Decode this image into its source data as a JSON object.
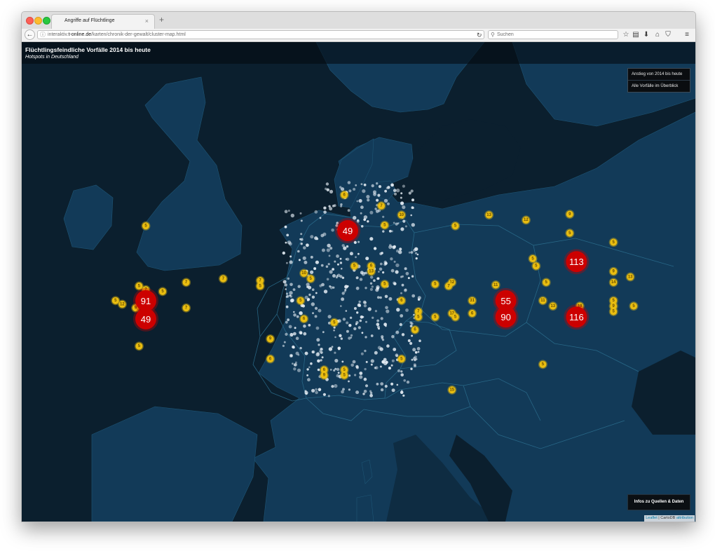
{
  "browser": {
    "tab_title": "Angriffe auf Flüchtlinge",
    "tab_close_glyph": "×",
    "new_tab_glyph": "+",
    "url": {
      "prefix": "interaktiv.",
      "domain": "t-online.de",
      "path": "/karten/chronik-der-gewalt/cluster-map.html"
    },
    "search_placeholder": "Suchen",
    "back_glyph": "←",
    "info_glyph": "ⓘ",
    "reload_glyph": "↻",
    "search_glyph": "⚲",
    "toolbar_icons": [
      {
        "name": "bookmark-star-icon",
        "glyph": "☆"
      },
      {
        "name": "reading-list-icon",
        "glyph": "▤"
      },
      {
        "name": "download-icon",
        "glyph": "⬇"
      },
      {
        "name": "home-icon",
        "glyph": "⌂"
      },
      {
        "name": "pocket-icon",
        "glyph": "⛉"
      },
      {
        "name": "menu-icon",
        "glyph": "≡"
      }
    ]
  },
  "page": {
    "title": "Flüchtlingsfeindliche Vorfälle 2014 bis heute",
    "subtitle": "Hotspots in Deutschland"
  },
  "view_controls": [
    {
      "label": "Anstieg von 2014 bis heute"
    },
    {
      "label": "Alle Vorfälle im Überblick"
    }
  ],
  "info_button_label": "Infos zu Quellen & Daten",
  "attribution": {
    "leaflet": "Leaflet",
    "separator": " | CartoDB ",
    "link": "attribution"
  },
  "colors": {
    "map_water": "#0b1f2e",
    "map_land": "#123a58",
    "map_border": "#2c6f8f",
    "large_cluster": "#cc0000",
    "medium_cluster": "#e9bd10",
    "medium_cluster_text": "#6a4f00",
    "point_dot": "#e6eef5"
  },
  "clusters_large": [
    {
      "count": "49",
      "lat": 53.37,
      "lng": 10.0
    },
    {
      "count": "113",
      "lat": 52.52,
      "lng": 13.4
    },
    {
      "count": "91",
      "lat": 51.45,
      "lng": 7.0
    },
    {
      "count": "49",
      "lat": 50.95,
      "lng": 7.0
    },
    {
      "count": "55",
      "lat": 51.45,
      "lng": 12.35
    },
    {
      "count": "90",
      "lat": 51.0,
      "lng": 12.35
    },
    {
      "count": "116",
      "lat": 51.0,
      "lng": 13.4
    }
  ],
  "clusters_medium": [
    {
      "count": "6",
      "lat": 54.35,
      "lng": 9.95
    },
    {
      "count": "7",
      "lat": 54.05,
      "lng": 10.5
    },
    {
      "count": "10",
      "lat": 53.8,
      "lng": 10.8
    },
    {
      "count": "13",
      "lat": 53.8,
      "lng": 12.1
    },
    {
      "count": "9",
      "lat": 53.82,
      "lng": 13.3
    },
    {
      "count": "12",
      "lat": 53.66,
      "lng": 12.65
    },
    {
      "count": "5",
      "lat": 53.52,
      "lng": 10.55
    },
    {
      "count": "5",
      "lat": 53.5,
      "lng": 11.6
    },
    {
      "count": "5",
      "lat": 53.5,
      "lng": 7.0
    },
    {
      "count": "5",
      "lat": 53.3,
      "lng": 13.3
    },
    {
      "count": "5",
      "lat": 53.05,
      "lng": 13.95
    },
    {
      "count": "5",
      "lat": 52.6,
      "lng": 12.75
    },
    {
      "count": "5",
      "lat": 52.4,
      "lng": 12.8
    },
    {
      "count": "9",
      "lat": 52.25,
      "lng": 13.95
    },
    {
      "count": "13",
      "lat": 52.1,
      "lng": 14.2
    },
    {
      "count": "14",
      "lat": 51.95,
      "lng": 13.95
    },
    {
      "count": "5",
      "lat": 52.4,
      "lng": 10.1
    },
    {
      "count": "6",
      "lat": 52.4,
      "lng": 10.35
    },
    {
      "count": "13",
      "lat": 52.25,
      "lng": 10.35
    },
    {
      "count": "10",
      "lat": 52.2,
      "lng": 9.35
    },
    {
      "count": "5",
      "lat": 52.05,
      "lng": 9.45
    },
    {
      "count": "7",
      "lat": 52.05,
      "lng": 8.15
    },
    {
      "count": "7",
      "lat": 52.0,
      "lng": 8.7
    },
    {
      "count": "7",
      "lat": 51.95,
      "lng": 7.6
    },
    {
      "count": "5",
      "lat": 51.85,
      "lng": 8.7
    },
    {
      "count": "5",
      "lat": 51.9,
      "lng": 10.55
    },
    {
      "count": "5",
      "lat": 51.9,
      "lng": 11.3
    },
    {
      "count": "12",
      "lat": 51.95,
      "lng": 11.55
    },
    {
      "count": "7",
      "lat": 51.85,
      "lng": 11.5
    },
    {
      "count": "11",
      "lat": 51.88,
      "lng": 12.2
    },
    {
      "count": "5",
      "lat": 51.95,
      "lng": 12.95
    },
    {
      "count": "5",
      "lat": 51.85,
      "lng": 6.9
    },
    {
      "count": "7",
      "lat": 51.75,
      "lng": 7.0
    },
    {
      "count": "5",
      "lat": 51.7,
      "lng": 7.25
    },
    {
      "count": "6",
      "lat": 51.6,
      "lng": 7.0
    },
    {
      "count": "5",
      "lat": 51.45,
      "lng": 6.55
    },
    {
      "count": "12",
      "lat": 51.35,
      "lng": 6.65
    },
    {
      "count": "9",
      "lat": 51.25,
      "lng": 6.85
    },
    {
      "count": "7",
      "lat": 51.25,
      "lng": 7.6
    },
    {
      "count": "5",
      "lat": 51.45,
      "lng": 9.3
    },
    {
      "count": "6",
      "lat": 51.45,
      "lng": 10.8
    },
    {
      "count": "31",
      "lat": 51.45,
      "lng": 11.85
    },
    {
      "count": "11",
      "lat": 51.45,
      "lng": 12.9
    },
    {
      "count": "5",
      "lat": 51.45,
      "lng": 13.95
    },
    {
      "count": "13",
      "lat": 51.3,
      "lng": 13.05
    },
    {
      "count": "19",
      "lat": 51.3,
      "lng": 13.45
    },
    {
      "count": "9",
      "lat": 51.3,
      "lng": 13.95
    },
    {
      "count": "5",
      "lat": 51.3,
      "lng": 14.25
    },
    {
      "count": "5",
      "lat": 51.15,
      "lng": 13.95
    },
    {
      "count": "7",
      "lat": 51.15,
      "lng": 11.05
    },
    {
      "count": "12",
      "lat": 51.1,
      "lng": 11.55
    },
    {
      "count": "6",
      "lat": 51.1,
      "lng": 11.85
    },
    {
      "count": "5",
      "lat": 51.0,
      "lng": 11.05
    },
    {
      "count": "5",
      "lat": 51.0,
      "lng": 11.3
    },
    {
      "count": "5",
      "lat": 51.0,
      "lng": 11.6
    },
    {
      "count": "6",
      "lat": 50.95,
      "lng": 9.35
    },
    {
      "count": "5",
      "lat": 50.85,
      "lng": 9.8
    },
    {
      "count": "6",
      "lat": 50.65,
      "lng": 11.0
    },
    {
      "count": "9",
      "lat": 50.4,
      "lng": 8.85
    },
    {
      "count": "5",
      "lat": 50.2,
      "lng": 6.9
    },
    {
      "count": "6",
      "lat": 49.85,
      "lng": 8.85
    },
    {
      "count": "5",
      "lat": 49.85,
      "lng": 10.8
    },
    {
      "count": "5",
      "lat": 49.7,
      "lng": 12.9
    },
    {
      "count": "6",
      "lat": 49.55,
      "lng": 9.65
    },
    {
      "count": "5",
      "lat": 49.55,
      "lng": 9.95
    },
    {
      "count": "9",
      "lat": 49.4,
      "lng": 9.65
    },
    {
      "count": "5",
      "lat": 49.4,
      "lng": 9.95
    },
    {
      "count": "15",
      "lat": 49.0,
      "lng": 11.55
    }
  ]
}
